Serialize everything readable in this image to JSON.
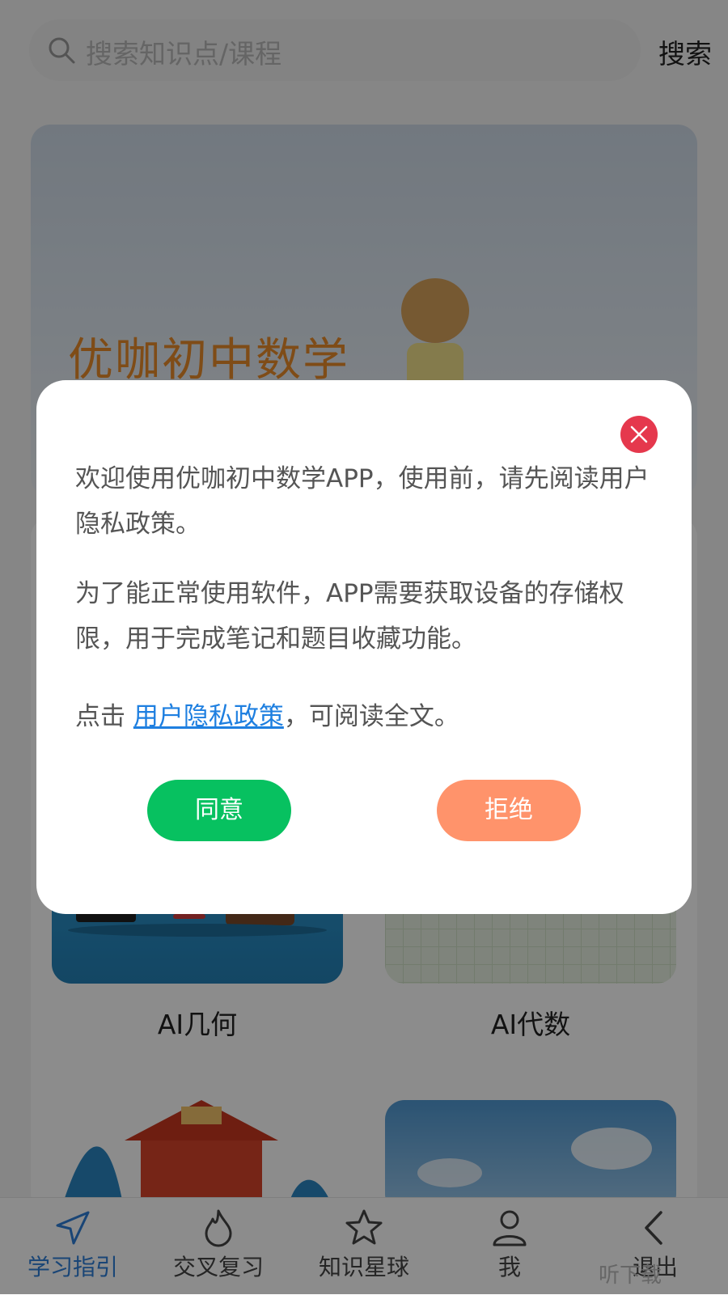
{
  "search": {
    "placeholder": "搜索知识点/课程",
    "button_label": "搜索"
  },
  "banner": {
    "title": "优咖初中数学"
  },
  "cards": [
    {
      "label": "AI几何"
    },
    {
      "label": "AI代数"
    }
  ],
  "bottom_nav": [
    {
      "label": "学习指引",
      "icon": "navigation-arrow-icon",
      "active": true
    },
    {
      "label": "交叉复习",
      "icon": "flame-icon"
    },
    {
      "label": "知识星球",
      "icon": "star-icon"
    },
    {
      "label": "我",
      "icon": "user-icon"
    },
    {
      "label": "退出",
      "icon": "chevron-left-icon"
    }
  ],
  "watermark": "听下载",
  "dialog": {
    "paragraph_1": "欢迎使用优咖初中数学APP，使用前，请先阅读用户隐私政策。",
    "paragraph_2": "为了能正常使用软件，APP需要获取设备的存储权限，用于完成笔记和题目收藏功能。",
    "paragraph_3_prefix": "点击 ",
    "policy_link": "用户隐私政策",
    "paragraph_3_suffix": "，可阅读全文。",
    "agree_label": "同意",
    "reject_label": "拒绝"
  },
  "colors": {
    "accent_blue": "#2f7fd8",
    "agree_green": "#07c160",
    "reject_orange": "#ff936b",
    "close_red": "#e5384d",
    "banner_title_orange": "#e78b2b"
  }
}
